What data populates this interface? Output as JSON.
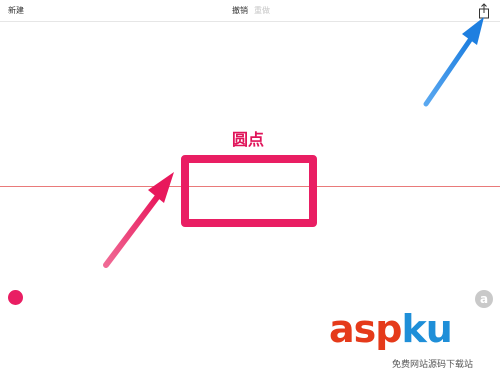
{
  "toolbar": {
    "new_label": "新建",
    "undo_label": "撤销",
    "redo_label": "重做",
    "share_icon": "share-icon"
  },
  "canvas": {
    "shape_label": "圆点",
    "dot_tool_icon": "dot-icon",
    "a_button_label": "a"
  },
  "watermark": {
    "main_prefix": "asp",
    "main_suffix": "ku",
    "sub": "免费网站源码下载站"
  },
  "colors": {
    "accent": "#e91e63",
    "guide_line": "#e97a7a",
    "annotation_arrow_pink": "#ea2a6a",
    "annotation_arrow_blue": "#1e88e5"
  }
}
